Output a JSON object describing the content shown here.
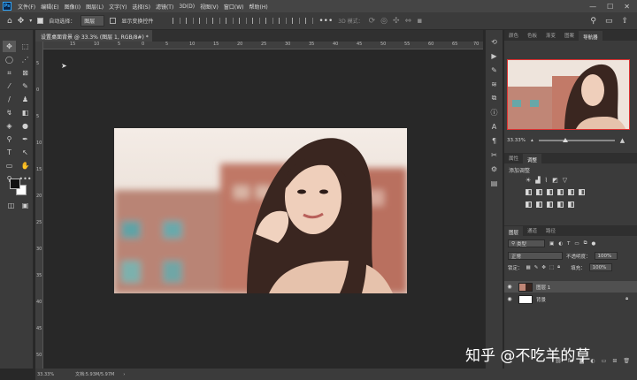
{
  "menubar": {
    "items": [
      "文件(F)",
      "编辑(E)",
      "图像(I)",
      "图层(L)",
      "文字(Y)",
      "选择(S)",
      "滤镜(T)",
      "3D(D)",
      "视图(V)",
      "窗口(W)",
      "帮助(H)"
    ]
  },
  "options": {
    "auto_select_label": "自动选择：",
    "auto_select_value": "图层",
    "transform_label": "显示变换控件",
    "mode_label": "3D 模式："
  },
  "document": {
    "tab_title": "设置桌面背景 @ 33.3% (图层 1, RGB/8#) *"
  },
  "ruler": {
    "top_ticks": [
      "15",
      "10",
      "5",
      "0",
      "5",
      "10",
      "15",
      "20",
      "25",
      "30",
      "35",
      "40",
      "45",
      "50",
      "55",
      "60",
      "65",
      "70"
    ],
    "left_ticks": [
      "5",
      "0",
      "5",
      "10",
      "15",
      "20",
      "25",
      "30",
      "35",
      "40",
      "45",
      "50"
    ]
  },
  "status": {
    "zoom": "33.33%",
    "doc_info": "文档:5.93M/5.97M"
  },
  "navigator": {
    "tabs": [
      "颜色",
      "色板",
      "渐变",
      "图案",
      "导航器"
    ],
    "zoom": "33.33%",
    "zoom_level": 0.35
  },
  "adjustments": {
    "tabs": [
      "属性",
      "调整"
    ],
    "title": "添加调整"
  },
  "layers": {
    "tabs": [
      "图层",
      "通道",
      "路径"
    ],
    "filter_label": "类型",
    "blend_mode": "正常",
    "opacity_label": "不透明度：",
    "opacity": "100%",
    "lock_label": "锁定：",
    "fill_label": "填充：",
    "fill": "100%",
    "items": [
      {
        "name": "图层 1",
        "selected": true
      },
      {
        "name": "背景",
        "selected": false
      }
    ]
  },
  "watermark": "知乎 @不吃羊的草"
}
